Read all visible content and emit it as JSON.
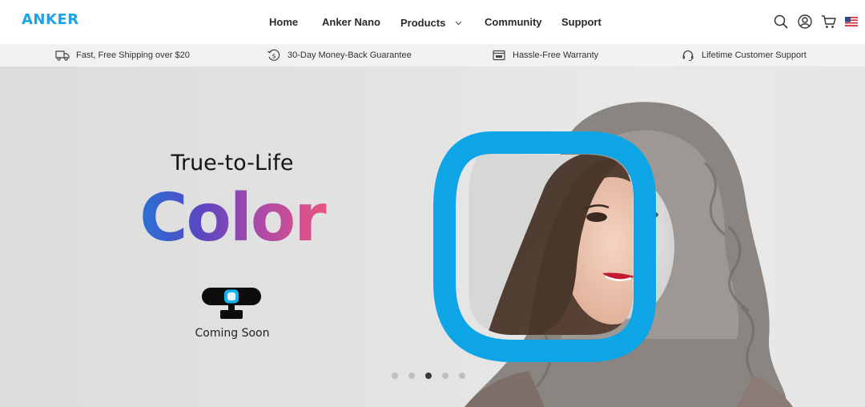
{
  "brand": {
    "logo_text": "ANKER",
    "accent_color": "#1aa3e8"
  },
  "nav": {
    "items": [
      {
        "label": "Home"
      },
      {
        "label": "Anker Nano"
      },
      {
        "label": "Products",
        "has_dropdown": true
      },
      {
        "label": "Community"
      },
      {
        "label": "Support"
      }
    ]
  },
  "header_icons": [
    "search-icon",
    "account-icon",
    "cart-icon",
    "us-flag-icon"
  ],
  "benefits": [
    {
      "icon": "truck-icon",
      "label": "Fast, Free Shipping over $20"
    },
    {
      "icon": "money-back-icon",
      "label": "30-Day Money-Back Guarantee"
    },
    {
      "icon": "warranty-icon",
      "label": "Hassle-Free Warranty"
    },
    {
      "icon": "headset-icon",
      "label": "Lifetime Customer Support"
    }
  ],
  "hero": {
    "tagline": "True-to-Life",
    "headline": "Color",
    "cta_text": "Coming Soon",
    "headline_gradient": [
      "#1f7ad8",
      "#5a46c2",
      "#b14aa6",
      "#f0577a"
    ],
    "frame_color": "#0ea5e6",
    "carousel": {
      "total": 5,
      "active_index": 2
    }
  }
}
